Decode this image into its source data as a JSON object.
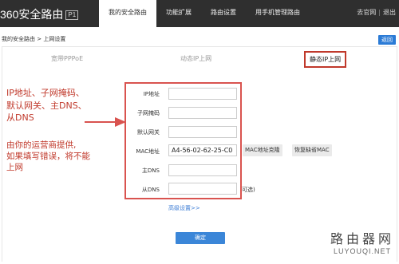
{
  "header": {
    "logo_text": "360安全路由",
    "logo_badge": "P1",
    "nav": [
      {
        "label": "我的安全路由",
        "active": true
      },
      {
        "label": "功能扩展",
        "active": false
      },
      {
        "label": "路由设置",
        "active": false
      },
      {
        "label": "用手机管理路由",
        "active": false
      }
    ],
    "links": {
      "website": "去官网",
      "separator": "|",
      "logout": "退出"
    }
  },
  "breadcrumb": "我的安全路由 > 上网设置",
  "back_label": "返回",
  "tabs": [
    {
      "label": "宽带PPPoE",
      "active": false
    },
    {
      "label": "动态IP上网",
      "active": false
    },
    {
      "label": "静态IP上网",
      "active": true
    }
  ],
  "annotation": {
    "note1_lines": [
      "IP地址、子网掩码、",
      "默认网关、主DNS、",
      "从DNS"
    ],
    "note2_lines": [
      "由你的运营商提供,",
      "如果填写错误，将不能",
      "上网"
    ],
    "color": "#c0392b"
  },
  "form": {
    "fields": [
      {
        "label": "IP地址",
        "value": ""
      },
      {
        "label": "子网掩码",
        "value": ""
      },
      {
        "label": "默认网关",
        "value": ""
      },
      {
        "label": "MAC地址",
        "value": "A4-56-02-62-25-C0"
      },
      {
        "label": "主DNS",
        "value": ""
      },
      {
        "label": "从DNS",
        "value": ""
      }
    ],
    "clone_mac_label": "MAC地址克隆",
    "restore_mac_label": "恢复缺省MAC",
    "optional_label": "可选)",
    "advanced_label": "高级设置>>",
    "confirm_label": "确定"
  },
  "watermark": {
    "cn": "路由器网",
    "en": "LUYOUQI.NET"
  }
}
